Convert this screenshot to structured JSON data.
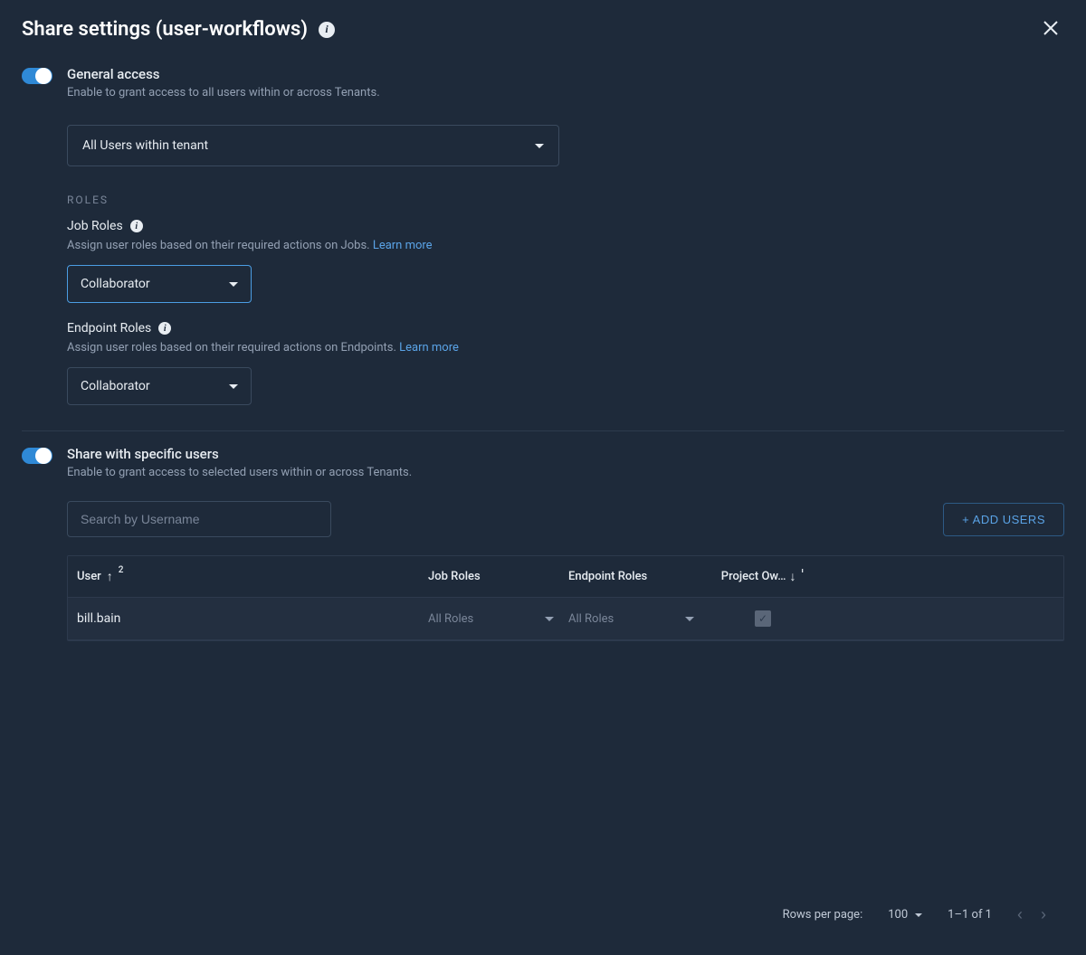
{
  "header": {
    "title": "Share settings (user-workflows)"
  },
  "general_access": {
    "title": "General access",
    "desc": "Enable to grant access to all users within or across Tenants.",
    "scope_selected": "All Users within tenant",
    "roles_heading": "ROLES",
    "job_roles": {
      "label": "Job Roles",
      "desc": "Assign user roles based on their required actions on Jobs. ",
      "learn_more": "Learn more",
      "selected": "Collaborator"
    },
    "endpoint_roles": {
      "label": "Endpoint Roles",
      "desc": "Assign user roles based on their required actions on Endpoints. ",
      "learn_more": "Learn more",
      "selected": "Collaborator"
    }
  },
  "specific_users": {
    "title": "Share with specific users",
    "desc": "Enable to grant access to selected users within or across Tenants.",
    "search_placeholder": "Search by Username",
    "add_button": "+ ADD USERS",
    "columns": {
      "user": "User",
      "user_sort_badge": "2",
      "job_roles": "Job Roles",
      "endpoint_roles": "Endpoint Roles",
      "project_owner": "Project Ow…",
      "owner_sort_badge": "1"
    },
    "rows": [
      {
        "user": "bill.bain",
        "job_roles": "All Roles",
        "endpoint_roles": "All Roles",
        "project_owner": true
      }
    ],
    "pagination": {
      "rows_label": "Rows per page:",
      "rows_value": "100",
      "range": "1–1 of 1"
    }
  }
}
